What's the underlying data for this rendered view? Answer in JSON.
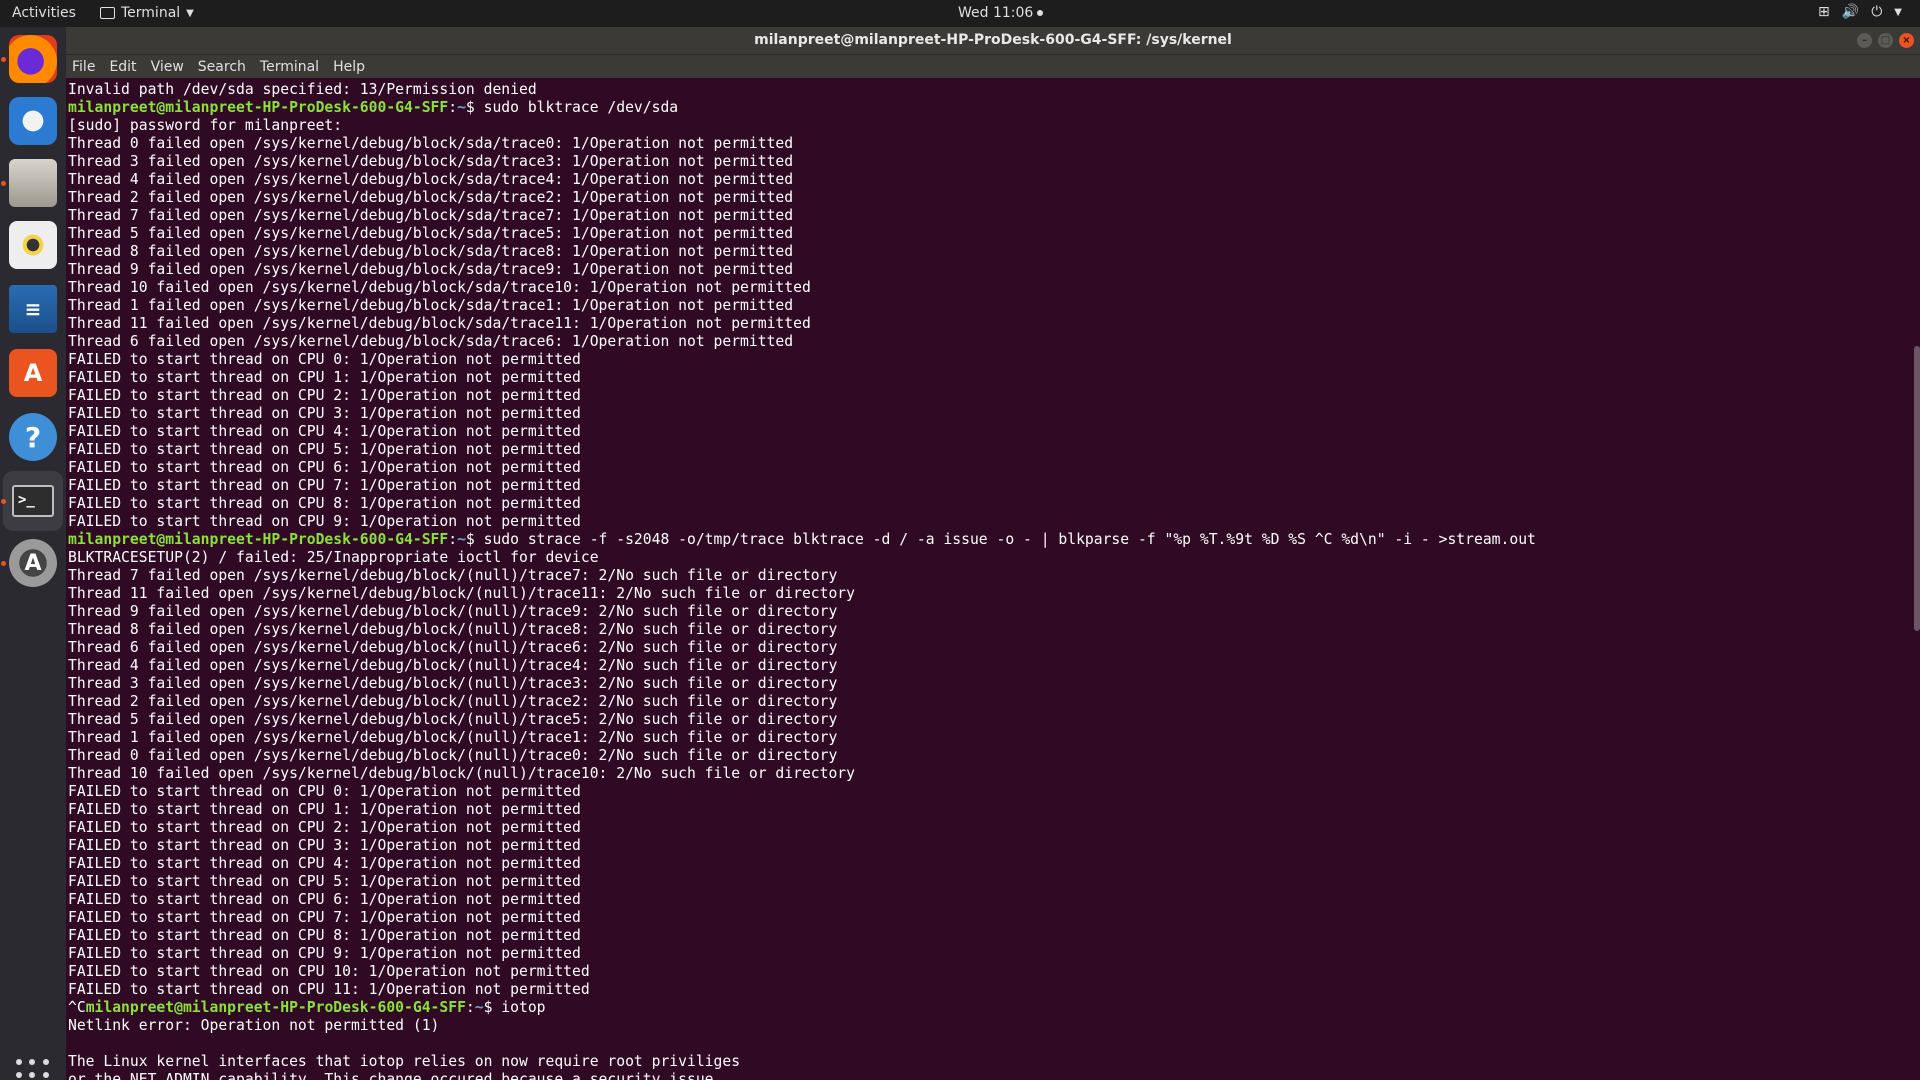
{
  "topbar": {
    "activities": "Activities",
    "app_menu": "Terminal",
    "clock": "Wed 11:06"
  },
  "window": {
    "title": "milanpreet@milanpreet-HP-ProDesk-600-G4-SFF: /sys/kernel"
  },
  "menu": [
    "File",
    "Edit",
    "View",
    "Search",
    "Terminal",
    "Help"
  ],
  "dock": {
    "items": [
      "firefox-icon",
      "thunderbird-icon",
      "files-icon",
      "rhythmbox-icon",
      "libreoffice-writer-icon",
      "ubuntu-software-icon",
      "help-icon",
      "terminal-icon",
      "software-updater-icon"
    ],
    "accent": "#e95420"
  },
  "colors": {
    "terminal_bg": "#300a24",
    "prompt_green": "#8ae234",
    "path_blue": "#729fcf"
  },
  "terminal": {
    "lines": [
      {
        "text": "Invalid path /dev/sda specified: 13/Permission denied"
      },
      {
        "prompt": "milanpreet@milanpreet-HP-ProDesk-600-G4-SFF",
        "path": "~",
        "cmd": " sudo blktrace /dev/sda"
      },
      {
        "text": "[sudo] password for milanpreet:"
      },
      {
        "text": "Thread 0 failed open /sys/kernel/debug/block/sda/trace0: 1/Operation not permitted"
      },
      {
        "text": "Thread 3 failed open /sys/kernel/debug/block/sda/trace3: 1/Operation not permitted"
      },
      {
        "text": "Thread 4 failed open /sys/kernel/debug/block/sda/trace4: 1/Operation not permitted"
      },
      {
        "text": "Thread 2 failed open /sys/kernel/debug/block/sda/trace2: 1/Operation not permitted"
      },
      {
        "text": "Thread 7 failed open /sys/kernel/debug/block/sda/trace7: 1/Operation not permitted"
      },
      {
        "text": "Thread 5 failed open /sys/kernel/debug/block/sda/trace5: 1/Operation not permitted"
      },
      {
        "text": "Thread 8 failed open /sys/kernel/debug/block/sda/trace8: 1/Operation not permitted"
      },
      {
        "text": "Thread 9 failed open /sys/kernel/debug/block/sda/trace9: 1/Operation not permitted"
      },
      {
        "text": "Thread 10 failed open /sys/kernel/debug/block/sda/trace10: 1/Operation not permitted"
      },
      {
        "text": "Thread 1 failed open /sys/kernel/debug/block/sda/trace1: 1/Operation not permitted"
      },
      {
        "text": "Thread 11 failed open /sys/kernel/debug/block/sda/trace11: 1/Operation not permitted"
      },
      {
        "text": "Thread 6 failed open /sys/kernel/debug/block/sda/trace6: 1/Operation not permitted"
      },
      {
        "text": "FAILED to start thread on CPU 0: 1/Operation not permitted"
      },
      {
        "text": "FAILED to start thread on CPU 1: 1/Operation not permitted"
      },
      {
        "text": "FAILED to start thread on CPU 2: 1/Operation not permitted"
      },
      {
        "text": "FAILED to start thread on CPU 3: 1/Operation not permitted"
      },
      {
        "text": "FAILED to start thread on CPU 4: 1/Operation not permitted"
      },
      {
        "text": "FAILED to start thread on CPU 5: 1/Operation not permitted"
      },
      {
        "text": "FAILED to start thread on CPU 6: 1/Operation not permitted"
      },
      {
        "text": "FAILED to start thread on CPU 7: 1/Operation not permitted"
      },
      {
        "text": "FAILED to start thread on CPU 8: 1/Operation not permitted"
      },
      {
        "text": "FAILED to start thread on CPU 9: 1/Operation not permitted"
      },
      {
        "prompt": "milanpreet@milanpreet-HP-ProDesk-600-G4-SFF",
        "path": "~",
        "cmd": " sudo strace -f -s2048 -o/tmp/trace blktrace -d / -a issue -o - | blkparse -f \"%p %T.%9t %D %S ^C %d\\n\" -i - >stream.out"
      },
      {
        "text": "BLKTRACESETUP(2) / failed: 25/Inappropriate ioctl for device"
      },
      {
        "text": "Thread 7 failed open /sys/kernel/debug/block/(null)/trace7: 2/No such file or directory"
      },
      {
        "text": "Thread 11 failed open /sys/kernel/debug/block/(null)/trace11: 2/No such file or directory"
      },
      {
        "text": "Thread 9 failed open /sys/kernel/debug/block/(null)/trace9: 2/No such file or directory"
      },
      {
        "text": "Thread 8 failed open /sys/kernel/debug/block/(null)/trace8: 2/No such file or directory"
      },
      {
        "text": "Thread 6 failed open /sys/kernel/debug/block/(null)/trace6: 2/No such file or directory"
      },
      {
        "text": "Thread 4 failed open /sys/kernel/debug/block/(null)/trace4: 2/No such file or directory"
      },
      {
        "text": "Thread 3 failed open /sys/kernel/debug/block/(null)/trace3: 2/No such file or directory"
      },
      {
        "text": "Thread 2 failed open /sys/kernel/debug/block/(null)/trace2: 2/No such file or directory"
      },
      {
        "text": "Thread 5 failed open /sys/kernel/debug/block/(null)/trace5: 2/No such file or directory"
      },
      {
        "text": "Thread 1 failed open /sys/kernel/debug/block/(null)/trace1: 2/No such file or directory"
      },
      {
        "text": "Thread 0 failed open /sys/kernel/debug/block/(null)/trace0: 2/No such file or directory"
      },
      {
        "text": "Thread 10 failed open /sys/kernel/debug/block/(null)/trace10: 2/No such file or directory"
      },
      {
        "text": "FAILED to start thread on CPU 0: 1/Operation not permitted"
      },
      {
        "text": "FAILED to start thread on CPU 1: 1/Operation not permitted"
      },
      {
        "text": "FAILED to start thread on CPU 2: 1/Operation not permitted"
      },
      {
        "text": "FAILED to start thread on CPU 3: 1/Operation not permitted"
      },
      {
        "text": "FAILED to start thread on CPU 4: 1/Operation not permitted"
      },
      {
        "text": "FAILED to start thread on CPU 5: 1/Operation not permitted"
      },
      {
        "text": "FAILED to start thread on CPU 6: 1/Operation not permitted"
      },
      {
        "text": "FAILED to start thread on CPU 7: 1/Operation not permitted"
      },
      {
        "text": "FAILED to start thread on CPU 8: 1/Operation not permitted"
      },
      {
        "text": "FAILED to start thread on CPU 9: 1/Operation not permitted"
      },
      {
        "text": "FAILED to start thread on CPU 10: 1/Operation not permitted"
      },
      {
        "text": "FAILED to start thread on CPU 11: 1/Operation not permitted"
      },
      {
        "pre": "^C",
        "prompt": "milanpreet@milanpreet-HP-ProDesk-600-G4-SFF",
        "path": "~",
        "cmd": " iotop"
      },
      {
        "text": "Netlink error: Operation not permitted (1)"
      },
      {
        "text": ""
      },
      {
        "text": "The Linux kernel interfaces that iotop relies on now require root priviliges"
      },
      {
        "text": "or the NET_ADMIN capability. This change occured because a security issue"
      }
    ]
  }
}
